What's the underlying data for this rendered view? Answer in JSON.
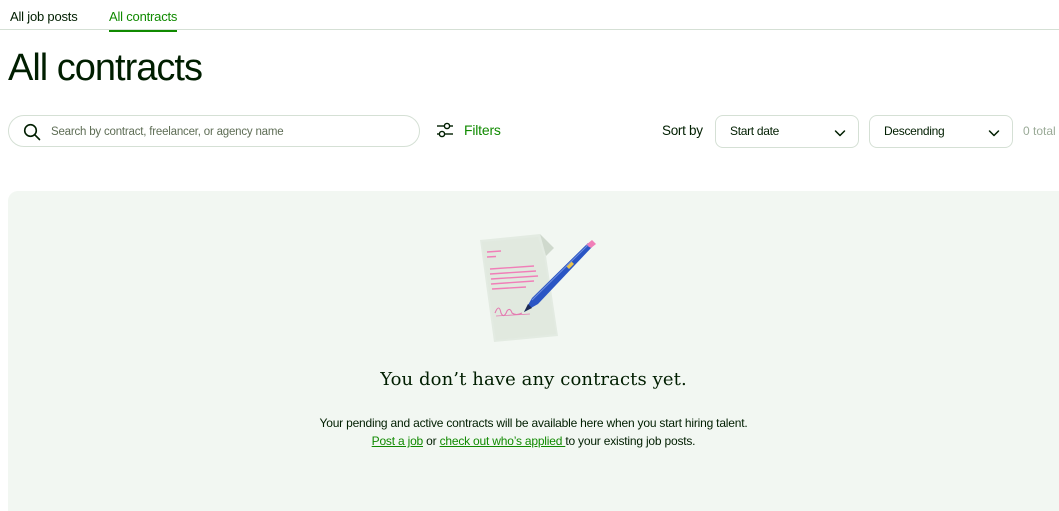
{
  "tabs": [
    {
      "label": "All job posts",
      "active": false
    },
    {
      "label": "All contracts",
      "active": true
    }
  ],
  "page_title": "All contracts",
  "search": {
    "placeholder": "Search by contract, freelancer, or agency name",
    "value": ""
  },
  "filters": {
    "label": "Filters",
    "icon": "sliders-icon"
  },
  "sort": {
    "label": "Sort by",
    "field": "Start date",
    "order": "Descending"
  },
  "total": "0 total",
  "empty_state": {
    "heading": "You don’t have any contracts yet.",
    "line1": "Your pending and active contracts will be available here when you start hiring talent.",
    "post_job_link": "Post a job",
    "or_text": " or ",
    "applied_link": "check out who’s applied ",
    "line2_tail": "to your existing job posts.",
    "illustration": "signed-contract-icon"
  },
  "colors": {
    "accent": "#108a00",
    "text": "#001e00",
    "panel": "#f2f7f2",
    "border": "#d5e0d5"
  }
}
